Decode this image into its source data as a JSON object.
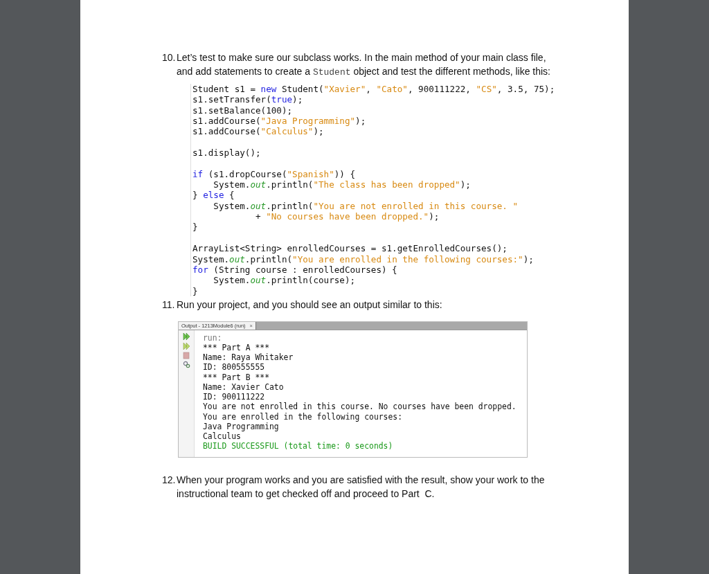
{
  "steps": [
    {
      "number": "10.",
      "paragraph": [
        {
          "kind": "text",
          "text": "Let’s test to make sure our subclass works. In the main method of your main class file, and add statements to create a "
        },
        {
          "kind": "code",
          "text": "Student"
        },
        {
          "kind": "text",
          "text": " object and test the different methods, like this:"
        }
      ],
      "code_blocks": [
        [
          [
            {
              "kind": "plain",
              "text": "Student s1 = "
            },
            {
              "kind": "keyword",
              "text": "new"
            },
            {
              "kind": "plain",
              "text": " Student("
            },
            {
              "kind": "string",
              "text": "\"Xavier\""
            },
            {
              "kind": "plain",
              "text": ", "
            },
            {
              "kind": "string",
              "text": "\"Cato\""
            },
            {
              "kind": "plain",
              "text": ", 900111222, "
            },
            {
              "kind": "string",
              "text": "\"CS\""
            },
            {
              "kind": "plain",
              "text": ", 3.5, 75);"
            }
          ],
          [
            {
              "kind": "plain",
              "text": "s1.setTransfer("
            },
            {
              "kind": "keyword",
              "text": "true"
            },
            {
              "kind": "plain",
              "text": ");"
            }
          ],
          [
            {
              "kind": "plain",
              "text": "s1.setBalance(100);"
            }
          ],
          [
            {
              "kind": "plain",
              "text": "s1.addCourse("
            },
            {
              "kind": "string",
              "text": "\"Java Programming\""
            },
            {
              "kind": "plain",
              "text": ");"
            }
          ],
          [
            {
              "kind": "plain",
              "text": "s1.addCourse("
            },
            {
              "kind": "string",
              "text": "\"Calculus\""
            },
            {
              "kind": "plain",
              "text": ");"
            }
          ]
        ],
        [
          [
            {
              "kind": "plain",
              "text": "s1.display();"
            }
          ]
        ],
        [
          [
            {
              "kind": "keyword",
              "text": "if"
            },
            {
              "kind": "plain",
              "text": " (s1.dropCourse("
            },
            {
              "kind": "string",
              "text": "\"Spanish\""
            },
            {
              "kind": "plain",
              "text": ")) {"
            }
          ],
          [
            {
              "kind": "plain",
              "text": "    System."
            },
            {
              "kind": "field",
              "text": "out"
            },
            {
              "kind": "plain",
              "text": ".println("
            },
            {
              "kind": "string",
              "text": "\"The class has been dropped\""
            },
            {
              "kind": "plain",
              "text": ");"
            }
          ],
          [
            {
              "kind": "plain",
              "text": "} "
            },
            {
              "kind": "keyword",
              "text": "else"
            },
            {
              "kind": "plain",
              "text": " {"
            }
          ],
          [
            {
              "kind": "plain",
              "text": "    System."
            },
            {
              "kind": "field",
              "text": "out"
            },
            {
              "kind": "plain",
              "text": ".println("
            },
            {
              "kind": "string",
              "text": "\"You are not enrolled in this course. \""
            }
          ],
          [
            {
              "kind": "plain",
              "text": "            + "
            },
            {
              "kind": "string",
              "text": "\"No courses have been dropped.\""
            },
            {
              "kind": "plain",
              "text": ");"
            }
          ],
          [
            {
              "kind": "plain",
              "text": "}"
            }
          ]
        ],
        [
          [
            {
              "kind": "plain",
              "text": "ArrayList<String> enrolledCourses = s1.getEnrolledCourses();"
            }
          ],
          [
            {
              "kind": "plain",
              "text": "System."
            },
            {
              "kind": "field",
              "text": "out"
            },
            {
              "kind": "plain",
              "text": ".println("
            },
            {
              "kind": "string",
              "text": "\"You are enrolled in the following courses:\""
            },
            {
              "kind": "plain",
              "text": ");"
            }
          ],
          [
            {
              "kind": "keyword",
              "text": "for"
            },
            {
              "kind": "plain",
              "text": " (String course : enrolledCourses) {"
            }
          ],
          [
            {
              "kind": "plain",
              "text": "    System."
            },
            {
              "kind": "field",
              "text": "out"
            },
            {
              "kind": "plain",
              "text": ".println(course);"
            }
          ],
          [
            {
              "kind": "plain",
              "text": "}"
            }
          ]
        ]
      ]
    },
    {
      "number": "11.",
      "paragraph": [
        {
          "kind": "text",
          "text": "Run your project, and you should see an output similar to this:"
        }
      ],
      "output_window": {
        "tab": {
          "label": "Output - 1213Module6 (run)",
          "close": "×"
        },
        "lines": [
          {
            "kind": "muted",
            "text": "run:"
          },
          {
            "kind": "plain",
            "text": "*** Part A ***"
          },
          {
            "kind": "plain",
            "text": "Name: Raya Whitaker"
          },
          {
            "kind": "plain",
            "text": "ID: 800555555"
          },
          {
            "kind": "plain",
            "text": "*** Part B ***"
          },
          {
            "kind": "plain",
            "text": "Name: Xavier Cato"
          },
          {
            "kind": "plain",
            "text": "ID: 900111222"
          },
          {
            "kind": "plain",
            "text": "You are not enrolled in this course. No courses have been dropped."
          },
          {
            "kind": "plain",
            "text": "You are enrolled in the following courses:"
          },
          {
            "kind": "plain",
            "text": "Java Programming"
          },
          {
            "kind": "plain",
            "text": "Calculus"
          },
          {
            "kind": "success",
            "text": "BUILD SUCCESSFUL (total time: 0 seconds)"
          }
        ]
      }
    },
    {
      "number": "12.",
      "paragraph": [
        {
          "kind": "text",
          "text": "When your program works and you are satisfied with the result, show your work to the instructional team to get checked off and proceed to Part  C."
        }
      ]
    }
  ]
}
